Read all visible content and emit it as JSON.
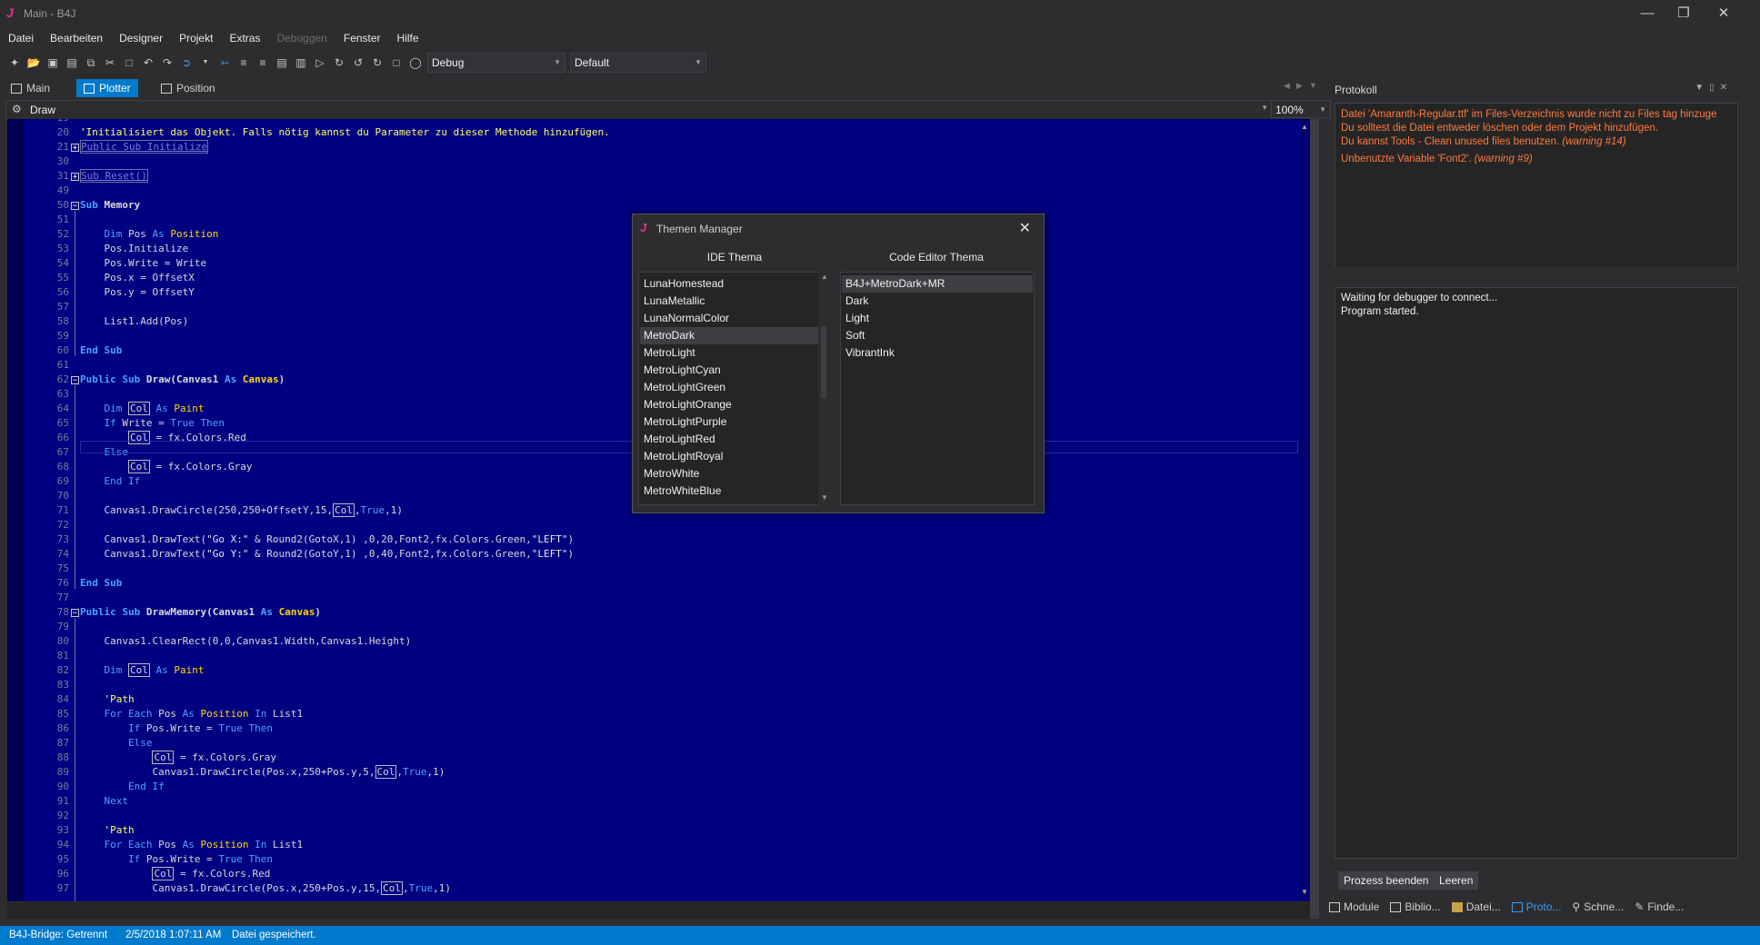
{
  "window": {
    "logo": "J",
    "title": "Main - B4J",
    "controls": [
      "—",
      "❐",
      "✕"
    ]
  },
  "menu": [
    {
      "label": "Datei",
      "enabled": true
    },
    {
      "label": "Bearbeiten",
      "enabled": true
    },
    {
      "label": "Designer",
      "enabled": true
    },
    {
      "label": "Projekt",
      "enabled": true
    },
    {
      "label": "Extras",
      "enabled": true
    },
    {
      "label": "Debuggen",
      "enabled": false
    },
    {
      "label": "Fenster",
      "enabled": true
    },
    {
      "label": "Hilfe",
      "enabled": true
    }
  ],
  "toolbar": {
    "build_config": "Debug",
    "theme_config": "Default"
  },
  "tabs": [
    {
      "label": "Main",
      "active": false
    },
    {
      "label": "Plotter",
      "active": true
    },
    {
      "label": "Position",
      "active": false
    }
  ],
  "subselector": {
    "label": "Draw"
  },
  "zoom": "100%",
  "editor": {
    "lines": [
      {
        "n": "19",
        "text": ""
      },
      {
        "n": "20",
        "text": "'Initialisiert das Objekt. Falls nötig kannst du Parameter zu dieser Methode hinzufügen."
      },
      {
        "n": "21",
        "text": "Public Sub Initialize"
      },
      {
        "n": "30",
        "text": ""
      },
      {
        "n": "31",
        "text": "Sub Reset()"
      },
      {
        "n": "49",
        "text": ""
      },
      {
        "n": "50",
        "text": "Sub Memory"
      },
      {
        "n": "51",
        "text": ""
      },
      {
        "n": "52",
        "text": "    Dim Pos As Position"
      },
      {
        "n": "53",
        "text": "    Pos.Initialize"
      },
      {
        "n": "54",
        "text": "    Pos.Write = Write"
      },
      {
        "n": "55",
        "text": "    Pos.x = OffsetX"
      },
      {
        "n": "56",
        "text": "    Pos.y = OffsetY"
      },
      {
        "n": "57",
        "text": ""
      },
      {
        "n": "58",
        "text": "    List1.Add(Pos)"
      },
      {
        "n": "59",
        "text": ""
      },
      {
        "n": "60",
        "text": "End Sub"
      },
      {
        "n": "61",
        "text": ""
      },
      {
        "n": "62",
        "text": "Public Sub Draw(Canvas1 As Canvas)"
      },
      {
        "n": "63",
        "text": ""
      },
      {
        "n": "64",
        "text": "    Dim Col As Paint"
      },
      {
        "n": "65",
        "text": "    If Write = True Then"
      },
      {
        "n": "66",
        "text": "        Col = fx.Colors.Red"
      },
      {
        "n": "67",
        "text": "    Else"
      },
      {
        "n": "68",
        "text": "        Col = fx.Colors.Gray"
      },
      {
        "n": "69",
        "text": "    End If"
      },
      {
        "n": "70",
        "text": ""
      },
      {
        "n": "71",
        "text": "    Canvas1.DrawCircle(250,250+OffsetY,15,Col,True,1)"
      },
      {
        "n": "72",
        "text": ""
      },
      {
        "n": "73",
        "text": "    Canvas1.DrawText(\"Go X:\" & Round2(GotoX,1) ,0,20,Font2,fx.Colors.Green,\"LEFT\")"
      },
      {
        "n": "74",
        "text": "    Canvas1.DrawText(\"Go Y:\" & Round2(GotoY,1) ,0,40,Font2,fx.Colors.Green,\"LEFT\")"
      },
      {
        "n": "75",
        "text": ""
      },
      {
        "n": "76",
        "text": "End Sub"
      },
      {
        "n": "77",
        "text": ""
      },
      {
        "n": "78",
        "text": "Public Sub DrawMemory(Canvas1 As Canvas)"
      },
      {
        "n": "79",
        "text": ""
      },
      {
        "n": "80",
        "text": "    Canvas1.ClearRect(0,0,Canvas1.Width,Canvas1.Height)"
      },
      {
        "n": "81",
        "text": ""
      },
      {
        "n": "82",
        "text": "    Dim Col As Paint"
      },
      {
        "n": "83",
        "text": ""
      },
      {
        "n": "84",
        "text": "    'Path"
      },
      {
        "n": "85",
        "text": "    For Each Pos As Position In List1"
      },
      {
        "n": "86",
        "text": "        If Pos.Write = True Then"
      },
      {
        "n": "87",
        "text": "        Else"
      },
      {
        "n": "88",
        "text": "            Col = fx.Colors.Gray"
      },
      {
        "n": "89",
        "text": "            Canvas1.DrawCircle(Pos.x,250+Pos.y,5,Col,True,1)"
      },
      {
        "n": "90",
        "text": "        End If"
      },
      {
        "n": "91",
        "text": "    Next"
      },
      {
        "n": "92",
        "text": ""
      },
      {
        "n": "93",
        "text": "    'Path"
      },
      {
        "n": "94",
        "text": "    For Each Pos As Position In List1"
      },
      {
        "n": "95",
        "text": "        If Pos.Write = True Then"
      },
      {
        "n": "96",
        "text": "            Col = fx.Colors.Red"
      },
      {
        "n": "97",
        "text": "            Canvas1.DrawCircle(Pos.x,250+Pos.y,15,Col,True,1)"
      }
    ]
  },
  "protokoll": {
    "title": "Protokoll",
    "warnings": [
      {
        "text": "Datei 'Amaranth-Regular.ttf' im Files-Verzeichnis wurde nicht zu Files tag hinzuge",
        "suffix": ""
      },
      {
        "text": "Du solltest die Datei entweder löschen oder dem Projekt hinzufügen.",
        "suffix": ""
      },
      {
        "text": "Du kannst Tools - Clean unused files benutzen. ",
        "suffix": "(warning #14)"
      },
      {
        "text": "Unbenutzte Variable 'Font2'. ",
        "suffix": "(warning #9)"
      }
    ],
    "output": [
      "Waiting for debugger to connect...",
      "Program started."
    ],
    "buttons": {
      "stop": "Prozess beenden",
      "clear": "Leeren"
    }
  },
  "bottom_tabs": [
    {
      "label": "Module",
      "active": false
    },
    {
      "label": "Biblio...",
      "active": false
    },
    {
      "label": "Datei...",
      "active": false
    },
    {
      "label": "Proto...",
      "active": true
    },
    {
      "label": "Schne...",
      "active": false
    },
    {
      "label": "Finde...",
      "active": false
    }
  ],
  "statusbar": {
    "bridge": "B4J-Bridge: Getrennt",
    "timestamp": "2/5/2018 1:07:11 AM",
    "message": "Datei gespeichert."
  },
  "dialog": {
    "logo": "J",
    "title": "Themen Manager",
    "ide_header": "IDE Thema",
    "code_header": "Code Editor Thema",
    "ide_themes": [
      "LunaHomestead",
      "LunaMetallic",
      "LunaNormalColor",
      "MetroDark",
      "MetroLight",
      "MetroLightCyan",
      "MetroLightGreen",
      "MetroLightOrange",
      "MetroLightPurple",
      "MetroLightRed",
      "MetroLightRoyal",
      "MetroWhite",
      "MetroWhiteBlue"
    ],
    "ide_selected": "MetroDark",
    "code_themes": [
      "B4J+MetroDark+MR",
      "Dark",
      "Light",
      "Soft",
      "VibrantInk"
    ],
    "code_selected": "B4J+MetroDark+MR"
  },
  "colors": {
    "editor_bg": "#000080",
    "accent": "#007acc",
    "warning": "#ff7a3c",
    "keyword": "#4aa3ff",
    "comment": "#ffff66",
    "type": "#ffd700"
  }
}
